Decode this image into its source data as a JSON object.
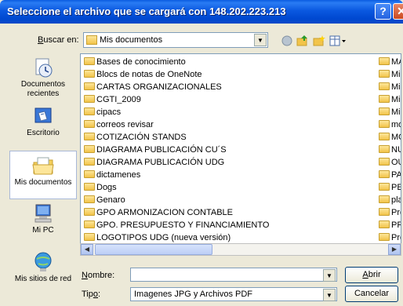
{
  "window": {
    "title": "Seleccione el archivo que se cargará con 148.202.223.213"
  },
  "toolbar": {
    "look_in_label_u": "B",
    "look_in_label_rest": "uscar en:",
    "look_in_value": "Mis documentos"
  },
  "places": [
    {
      "label": "Documentos recientes",
      "icon": "recent-documents-icon"
    },
    {
      "label": "Escritorio",
      "icon": "desktop-icon"
    },
    {
      "label": "Mis documentos",
      "icon": "my-documents-icon"
    },
    {
      "label": "Mi PC",
      "icon": "my-computer-icon"
    },
    {
      "label": "Mis sitios de red",
      "icon": "network-places-icon"
    }
  ],
  "files_col1": [
    "Bases de conocimiento",
    "Blocs de notas de OneNote",
    "CARTAS ORGANIZACIONALES",
    "CGTI_2009",
    "cipacs",
    "correos revisar",
    "COTIZACIÓN STANDS",
    "DIAGRAMA PUBLICACIÓN CU´S",
    "DIAGRAMA PUBLICACIÓN UDG",
    "dictamenes",
    "Dogs",
    "Genaro",
    "GPO ARMONIZACION CONTABLE",
    "GPO. PRESUPUESTO Y FINANCIAMIENTO",
    "LOGOTIPOS UDG (nueva versión)"
  ],
  "files_col2": [
    "MA",
    "Mi",
    "Mis",
    "Mis",
    "Mis",
    "mo",
    "MÓ",
    "NU",
    "OU",
    "PA",
    "PE",
    "pla",
    "Pro",
    "PR",
    "Pro"
  ],
  "form": {
    "name_label_u": "N",
    "name_label_rest": "ombre:",
    "name_value": "",
    "type_label_rest1": "Tip",
    "type_label_u": "o",
    "type_label_rest2": ":",
    "type_value": "Imagenes JPG y Archivos PDF",
    "open_u": "A",
    "open_rest": "brir",
    "cancel_label": "Cancelar"
  },
  "colors": {
    "title_bar": "#0a58e0",
    "dialog_bg": "#ece9d8",
    "border": "#7f9db9"
  }
}
